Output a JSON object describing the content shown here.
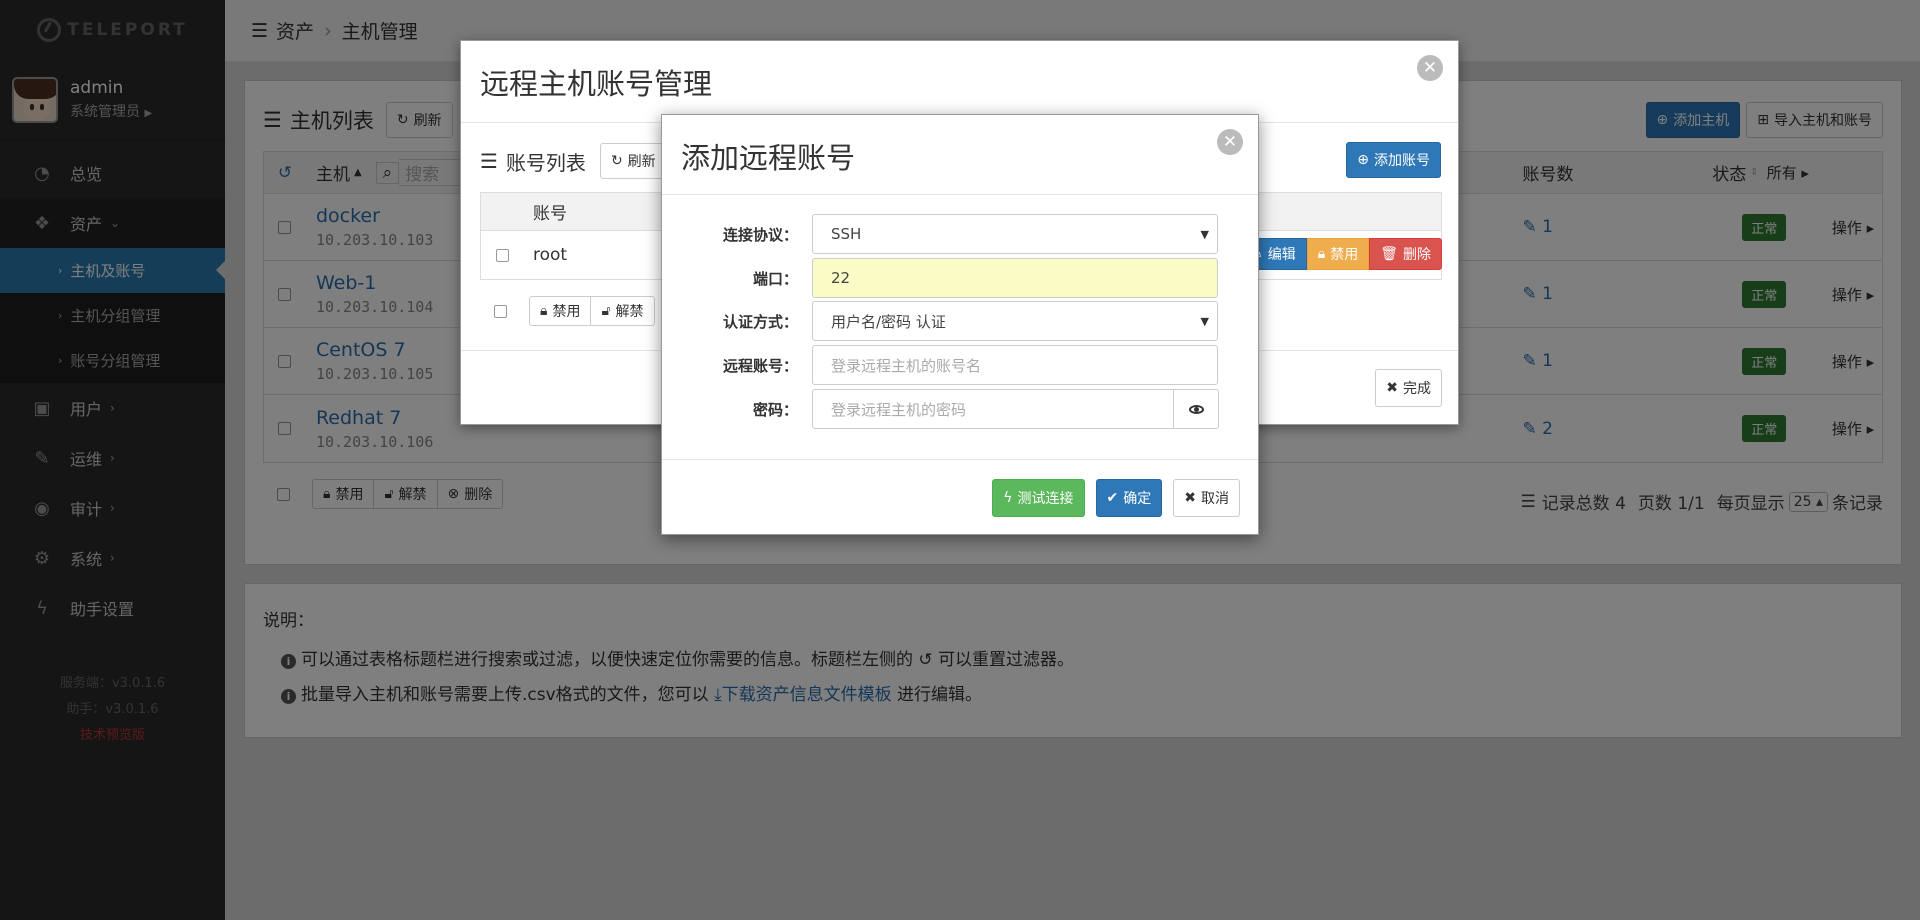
{
  "app": {
    "logo_text": "TELEPORT"
  },
  "user": {
    "name": "admin",
    "role": "系统管理员"
  },
  "nav": {
    "dashboard": "总览",
    "assets": "资产",
    "assets_sub": [
      "主机及账号",
      "主机分组管理",
      "账号分组管理"
    ],
    "users": "用户",
    "ops": "运维",
    "audit": "审计",
    "system": "系统",
    "assistant": "助手设置"
  },
  "versions": {
    "server": "服务端：v3.0.1.6",
    "assistant": "助手：v3.0.1.6",
    "preview": "技术预览版"
  },
  "breadcrumb": {
    "root": "资产",
    "current": "主机管理"
  },
  "host_panel": {
    "title": "主机列表",
    "refresh": "刷新",
    "add_host": "添加主机",
    "import": "导入主机和账号",
    "col_host": "主机",
    "search_placeholder": "搜索",
    "col_accounts": "账号数",
    "col_status": "状态",
    "status_filter": "所有",
    "rows": [
      {
        "name": "docker",
        "ip": "10.203.10.103",
        "accounts": "1",
        "status": "正常",
        "op": "操作"
      },
      {
        "name": "Web-1",
        "ip": "10.203.10.104",
        "accounts": "1",
        "status": "正常",
        "op": "操作"
      },
      {
        "name": "CentOS 7",
        "ip": "10.203.10.105",
        "accounts": "1",
        "status": "正常",
        "op": "操作"
      },
      {
        "name": "Redhat 7",
        "ip": "10.203.10.106",
        "accounts": "2",
        "status": "正常",
        "op": "操作"
      }
    ],
    "bulk": {
      "disable": "禁用",
      "enable": "解禁",
      "delete": "删除"
    },
    "paging": {
      "total": "记录总数 4",
      "pages": "页数 1/1",
      "per_page_label": "每页显示",
      "per_page": "25",
      "suffix": "条记录"
    }
  },
  "notes": {
    "title": "说明：",
    "line1_a": "可以通过表格标题栏进行搜索或过滤，以便快速定位你需要的信息。标题栏左侧的",
    "line1_b": "可以重置过滤器。",
    "line2_a": "批量导入主机和账号需要上传.csv格式的文件，您可以",
    "line2_link": "下载资产信息文件模板",
    "line2_b": "进行编辑。"
  },
  "outer_modal": {
    "title": "远程主机账号管理",
    "list_title": "账号列表",
    "refresh": "刷新",
    "add_account": "添加账号",
    "col_account": "账号",
    "rows": [
      {
        "account": "root"
      }
    ],
    "row_btns": {
      "edit": "编辑",
      "disable": "禁用",
      "delete": "删除"
    },
    "bulk": {
      "disable": "禁用",
      "enable": "解禁"
    },
    "done": "完成"
  },
  "inner_modal": {
    "title": "添加远程账号",
    "protocol_label": "连接协议：",
    "protocol_value": "SSH",
    "port_label": "端口：",
    "port_value": "22",
    "auth_label": "认证方式：",
    "auth_value": "用户名/密码 认证",
    "account_label": "远程账号：",
    "account_placeholder": "登录远程主机的账号名",
    "password_label": "密码：",
    "password_placeholder": "登录远程主机的密码",
    "test_btn": "测试连接",
    "ok_btn": "确定",
    "cancel_btn": "取消"
  },
  "colors": {
    "primary": "#2f78b7",
    "success": "#5cb85c",
    "warning": "#f0ad4e",
    "danger": "#d9534f",
    "status_ok": "#2e7d32",
    "sidebar": "#2b2b2b",
    "active_nav": "#2a7ab0"
  }
}
